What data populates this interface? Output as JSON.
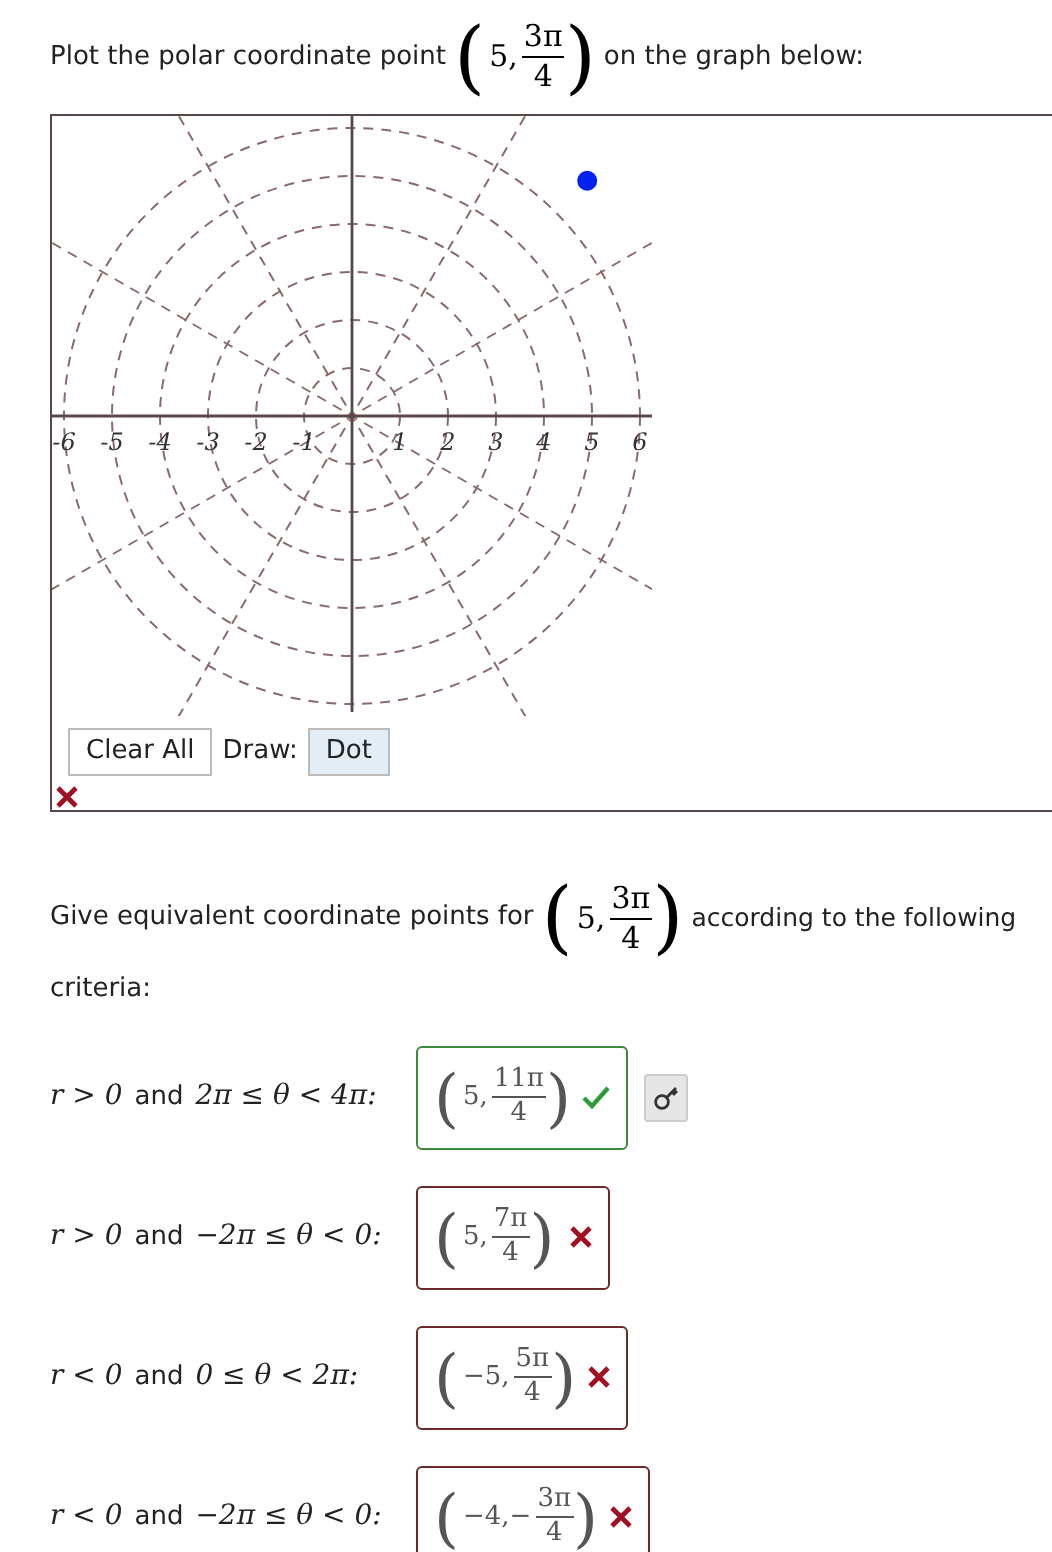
{
  "prompt": {
    "before": "Plot the polar coordinate point",
    "point": {
      "open": "(",
      "lead": "5,",
      "num": "3π",
      "den": "4",
      "close": ")"
    },
    "after": "on the graph below:"
  },
  "graph": {
    "tick_labels": [
      "-6",
      "-5",
      "-4",
      "-3",
      "-2",
      "-1",
      "1",
      "2",
      "3",
      "4",
      "5",
      "6"
    ],
    "buttons": [
      {
        "label": "Clear All",
        "selected": false
      }
    ],
    "draw_label": "Draw:",
    "tools": [
      {
        "label": "Dot",
        "selected": true
      }
    ],
    "correct": false
  },
  "question": {
    "before": "Give equivalent coordinate points for",
    "point": {
      "open": "(",
      "lead": "5,",
      "num": "3π",
      "den": "4",
      "close": ")"
    },
    "after": "according to the following",
    "wrap": "criteria:"
  },
  "criteria": [
    {
      "label": [
        {
          "kind": "math",
          "text": "r > 0"
        },
        {
          "kind": "text",
          "text": "and"
        },
        {
          "kind": "math",
          "text": "2π ≤ θ < 4π:"
        }
      ],
      "answer": {
        "open": "(",
        "lead": "5,",
        "num": "11π",
        "den": "4",
        "close": ")"
      },
      "correct": true,
      "key": true
    },
    {
      "label": [
        {
          "kind": "math",
          "text": "r > 0"
        },
        {
          "kind": "text",
          "text": "and"
        },
        {
          "kind": "math",
          "text": "−2π ≤ θ < 0:"
        }
      ],
      "answer": {
        "open": "(",
        "lead": "5,",
        "num": "7π",
        "den": "4",
        "close": ")"
      },
      "correct": false,
      "key": false
    },
    {
      "label": [
        {
          "kind": "math",
          "text": "r < 0"
        },
        {
          "kind": "text",
          "text": "and"
        },
        {
          "kind": "math",
          "text": "0 ≤ θ < 2π:"
        }
      ],
      "answer": {
        "open": "(",
        "lead": "−5,",
        "num": "5π",
        "den": "4",
        "close": ")"
      },
      "correct": false,
      "key": false
    },
    {
      "label": [
        {
          "kind": "math",
          "text": "r < 0"
        },
        {
          "kind": "text",
          "text": "and"
        },
        {
          "kind": "math",
          "text": "−2π ≤ θ < 0:"
        }
      ],
      "answer": {
        "open": "(",
        "lead": "−4,−",
        "num": "3π",
        "den": "4",
        "close": ")"
      },
      "correct": false,
      "key": false
    }
  ]
}
